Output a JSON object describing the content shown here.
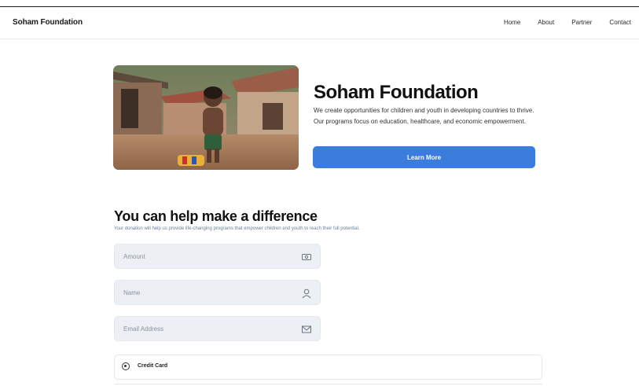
{
  "nav": {
    "brand": "Soham Foundation",
    "links": [
      "Home",
      "About",
      "Partner",
      "Contact"
    ]
  },
  "hero": {
    "title": "Soham Foundation",
    "description": "We create opportunities for children and youth in developing countries to thrive. Our programs focus on education, healthcare, and economic empowerment.",
    "button_label": "Learn More",
    "image_icon": "child-village-photo"
  },
  "donate": {
    "title": "You can help make a difference",
    "subtitle": "Your donation will help us provide life-changing programs that empower children and youth to reach their full potential.",
    "fields": [
      {
        "label": "Amount",
        "icon": "cash-icon"
      },
      {
        "label": "Name",
        "icon": "user-icon"
      },
      {
        "label": "Email  Address",
        "icon": "mail-icon"
      }
    ],
    "payment_option": "Credit Card"
  },
  "colors": {
    "accent": "#3b7ddd",
    "field_bg": "#eceff3"
  }
}
